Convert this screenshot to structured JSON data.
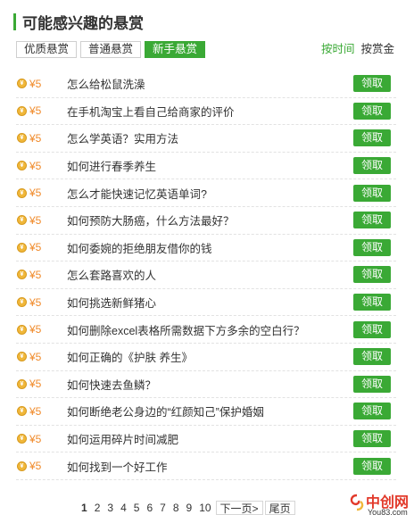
{
  "header": {
    "title": "可能感兴趣的悬赏"
  },
  "tabs": [
    {
      "label": "优质悬赏",
      "active": false
    },
    {
      "label": "普通悬赏",
      "active": false
    },
    {
      "label": "新手悬赏",
      "active": true
    }
  ],
  "sort": {
    "by_time": "按时间",
    "by_amount": "按赏金"
  },
  "coin_glyph": "¥",
  "items": [
    {
      "reward": "¥5",
      "title": "怎么给松鼠洗澡",
      "action": "领取"
    },
    {
      "reward": "¥5",
      "title": "在手机淘宝上看自己给商家的评价",
      "action": "领取"
    },
    {
      "reward": "¥5",
      "title": "怎么学英语？实用方法",
      "action": "领取"
    },
    {
      "reward": "¥5",
      "title": "如何进行春季养生",
      "action": "领取"
    },
    {
      "reward": "¥5",
      "title": "怎么才能快速记忆英语单词?",
      "action": "领取"
    },
    {
      "reward": "¥5",
      "title": "如何预防大肠癌，什么方法最好？",
      "action": "领取"
    },
    {
      "reward": "¥5",
      "title": "如何委婉的拒绝朋友借你的钱",
      "action": "领取"
    },
    {
      "reward": "¥5",
      "title": "怎么套路喜欢的人",
      "action": "领取"
    },
    {
      "reward": "¥5",
      "title": "如何挑选新鲜猪心",
      "action": "领取"
    },
    {
      "reward": "¥5",
      "title": "如何删除excel表格所需数据下方多余的空白行？",
      "action": "领取"
    },
    {
      "reward": "¥5",
      "title": "如何正确的《护肤 养生》",
      "action": "领取"
    },
    {
      "reward": "¥5",
      "title": "如何快速去鱼鳞？",
      "action": "领取"
    },
    {
      "reward": "¥5",
      "title": "如何断绝老公身边的“红颜知己”保护婚姻",
      "action": "领取"
    },
    {
      "reward": "¥5",
      "title": "如何运用碎片时间减肥",
      "action": "领取"
    },
    {
      "reward": "¥5",
      "title": "如何找到一个好工作",
      "action": "领取"
    }
  ],
  "pagination": {
    "pages": [
      "1",
      "2",
      "3",
      "4",
      "5",
      "6",
      "7",
      "8",
      "9",
      "10"
    ],
    "current": "1",
    "next": "下一页>",
    "last": "尾页"
  },
  "watermark": {
    "text": "中创网",
    "url": "You83.com"
  },
  "colors": {
    "accent": "#3aa935",
    "reward": "#f08a2a",
    "coin": "#f0b73a",
    "logo": "#e23a2b"
  }
}
